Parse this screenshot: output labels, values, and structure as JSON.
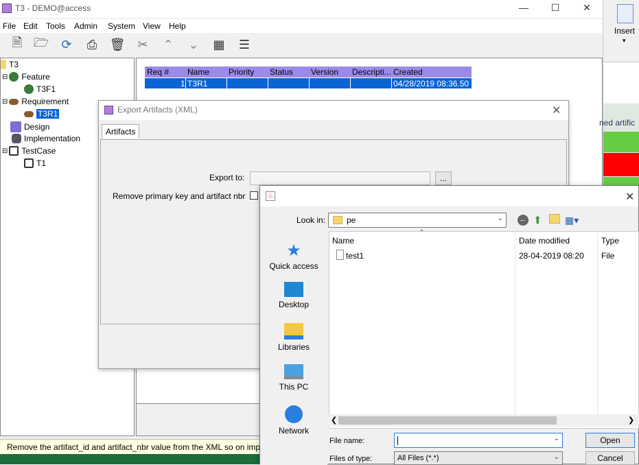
{
  "main": {
    "title": "T3 - DEMO@access",
    "menu": [
      "File",
      "Edit",
      "Tools",
      "Admin",
      "System",
      "View",
      "Help"
    ],
    "toolbar_icons": [
      "new-document-icon",
      "open-folder-icon",
      "refresh-icon",
      "print-icon",
      "delete-icon",
      "cut-icon",
      "up-arrow-icon",
      "down-arrow-icon",
      "columns-icon",
      "scroll-icon"
    ]
  },
  "tree": {
    "root": "T3",
    "items": [
      {
        "label": "Feature"
      },
      {
        "label": "T3F1"
      },
      {
        "label": "Requirement"
      },
      {
        "label": "T3R1"
      },
      {
        "label": "Design"
      },
      {
        "label": "Implementation"
      },
      {
        "label": "TestCase"
      },
      {
        "label": "T1"
      }
    ]
  },
  "grid": {
    "columns": [
      "Req #",
      "Name",
      "Priority",
      "Status",
      "Version",
      "Descripti...",
      "Created"
    ],
    "rows": [
      [
        "1",
        "T3R1",
        "",
        "",
        "",
        "",
        "04/28/2019 08:36.50"
      ]
    ]
  },
  "right_panel": {
    "insert_label": "Insert",
    "cut_text": "ned artific"
  },
  "status": {
    "text": "Remove the artifact_id and artifact_nbr value from the XML so on imp"
  },
  "export_dialog": {
    "title": "Export Artifacts (XML)",
    "tab": "Artifacts",
    "export_to_label": "Export to:",
    "export_to_value": "",
    "browse_label": "...",
    "remove_pk_label": "Remove primary key and artifact nbr"
  },
  "file_dialog": {
    "look_in_label": "Look in:",
    "look_in_value": "pe",
    "places": [
      "Quick access",
      "Desktop",
      "Libraries",
      "This PC",
      "Network"
    ],
    "columns": [
      "Name",
      "Date modified",
      "Type"
    ],
    "files": [
      {
        "name": "test1",
        "date": "28-04-2019 08:20",
        "type": "File"
      }
    ],
    "file_name_label": "File name:",
    "file_name_value": "",
    "file_type_label": "Files of type:",
    "file_type_value": "All Files (*.*)",
    "open_label": "Open",
    "cancel_label": "Cancel"
  },
  "colors": {
    "selection": "#0a64d6",
    "grid_header": "#9b8ae8",
    "status_bg": "#ffffe1",
    "panel_green": "#66cc44",
    "panel_red": "#ff0000",
    "bottom_green": "#1e6b3c"
  }
}
